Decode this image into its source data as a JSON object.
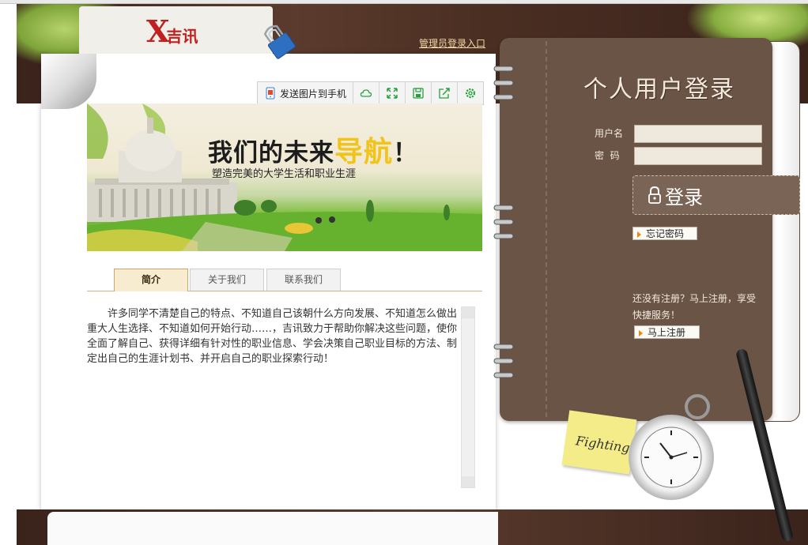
{
  "header": {
    "logo_text": "吉讯",
    "admin_link": "管理员登录入口"
  },
  "toolbar": {
    "send_label": "发送图片到手机",
    "icons": [
      "phone-image-icon",
      "cloud-icon",
      "expand-icon",
      "save-icon",
      "share-icon",
      "gear-icon"
    ]
  },
  "banner": {
    "title_main": "我们的未来",
    "title_highlight": "导航",
    "title_suffix": "！",
    "subtitle": "塑造完美的大学生活和职业生涯"
  },
  "tabs": [
    {
      "label": "简介",
      "active": true
    },
    {
      "label": "关于我们",
      "active": false
    },
    {
      "label": "联系我们",
      "active": false
    }
  ],
  "intro": {
    "text": "许多同学不清楚自己的特点、不知道自己该朝什么方向发展、不知道怎么做出重大人生选择、不知道如何开始行动……，吉讯致力于帮助你解决这些问题，使你全面了解自己、获得详细有针对性的职业信息、学会决策自己职业目标的方法、制定出自己的生涯计划书、并开启自己的职业探索行动！"
  },
  "login": {
    "title": "个人用户登录",
    "username_label": "用户名",
    "password_label": "密  码",
    "username_value": "",
    "password_value": "",
    "login_button": "登录",
    "forgot_button": "忘记密码",
    "register_prompt": "还没有注册？马上注册，享受快捷服务！",
    "register_button": "马上注册"
  },
  "decor": {
    "sticky_note": "Fighting"
  },
  "colors": {
    "notebook": "#6a5446",
    "accent": "#e38a14",
    "brand_red": "#c0201f"
  }
}
